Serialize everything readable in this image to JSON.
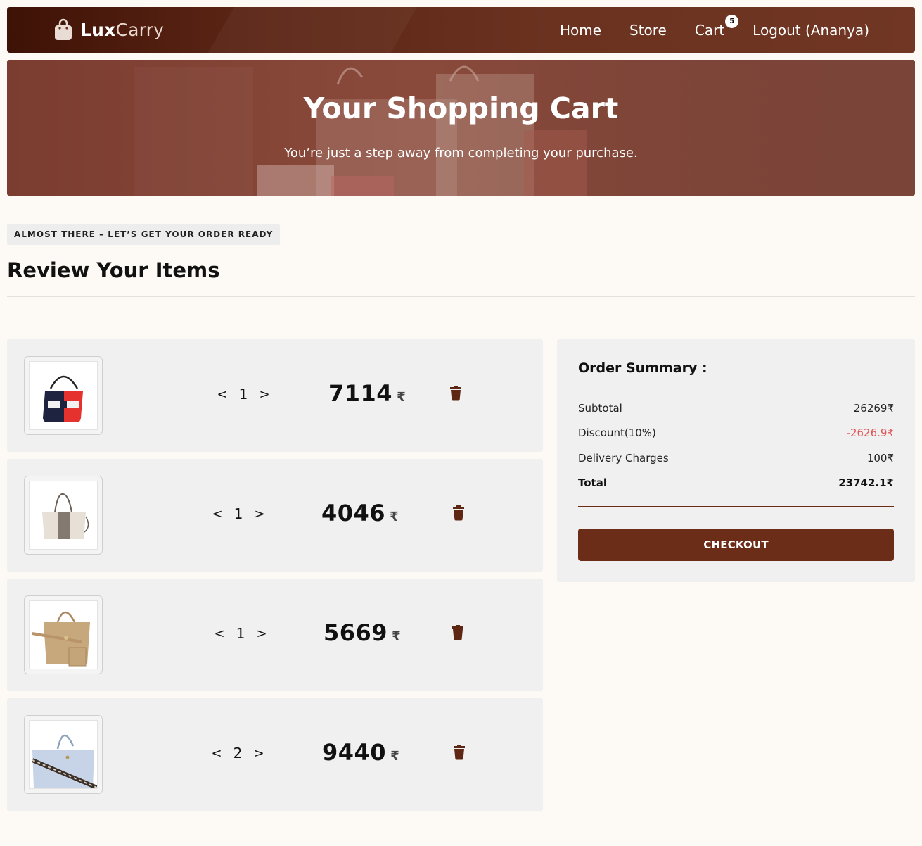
{
  "navbar": {
    "logo_lux": "Lux",
    "logo_carry": "Carry",
    "links": {
      "home": "Home",
      "store": "Store",
      "cart": "Cart",
      "logout": "Logout (Ananya)"
    },
    "cart_count": "5"
  },
  "hero": {
    "title": "Your Shopping Cart",
    "subtitle": "You’re just a step away from completing your purchase."
  },
  "section": {
    "tagline": "ALMOST THERE – LET’S GET YOUR ORDER READY",
    "title": "Review Your Items"
  },
  "cart_items": [
    {
      "qty": "1",
      "price": "7114",
      "currency": "₹",
      "dec": "<",
      "inc": ">"
    },
    {
      "qty": "1",
      "price": "4046",
      "currency": "₹",
      "dec": "<",
      "inc": ">"
    },
    {
      "qty": "1",
      "price": "5669",
      "currency": "₹",
      "dec": "<",
      "inc": ">"
    },
    {
      "qty": "2",
      "price": "9440",
      "currency": "₹",
      "dec": "<",
      "inc": ">"
    }
  ],
  "summary": {
    "title": "Order Summary :",
    "subtotal_label": "Subtotal",
    "subtotal_value": "26269₹",
    "discount_label": "Discount(10%)",
    "discount_value": "-2626.9₹",
    "delivery_label": "Delivery Charges",
    "delivery_value": "100₹",
    "total_label": "Total",
    "total_value": "23742.1₹",
    "checkout_label": "CHECKOUT"
  },
  "colors": {
    "brand_brown": "#6b2d17",
    "discount_red": "#e05555",
    "page_bg": "#fdf9f5"
  }
}
